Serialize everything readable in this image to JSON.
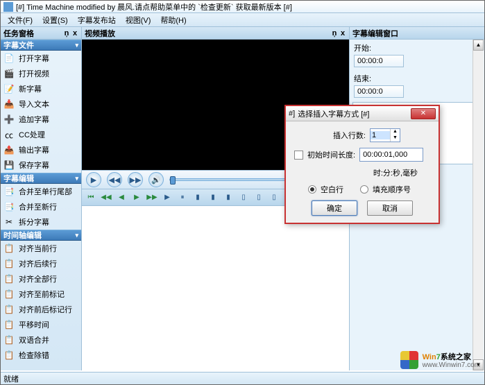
{
  "title": "[#] Time Machine modified by 晨风.请点帮助菜单中的 `检查更新` 获取最新版本 [#]",
  "menu": {
    "file": "文件(F)",
    "settings": "设置(S)",
    "publish": "字幕发布站",
    "view": "视图(V)",
    "help": "帮助(H)"
  },
  "panels": {
    "task": "任务窗格",
    "video": "视频播放",
    "edit": "字幕编辑窗口"
  },
  "pinclose": {
    "pin": "ņ",
    "close": "x"
  },
  "sidebar": {
    "sec1": {
      "title": "字幕文件",
      "items": [
        "打开字幕",
        "打开视频",
        "新字幕",
        "导入文本",
        "追加字幕",
        "CC处理",
        "输出字幕",
        "保存字幕"
      ]
    },
    "sec2": {
      "title": "字幕编辑",
      "items": [
        "合并至单行尾部",
        "合并至新行",
        "拆分字幕"
      ]
    },
    "sec3": {
      "title": "时间轴编辑",
      "items": [
        "对齐当前行",
        "对齐后续行",
        "对齐全部行",
        "对齐至前标记",
        "对齐前后标记行",
        "平移时间",
        "双语合并",
        "检查除错"
      ]
    }
  },
  "rightpanel": {
    "start": "开始:",
    "end": "结束:",
    "startv": "00:00:0",
    "endv": "00:00:0"
  },
  "dialog": {
    "title": "选择插入字幕方式 [#]",
    "insert_lines": "插入行数:",
    "lines_value": "1",
    "init_len_chk": "初始时间长度:",
    "init_len_val": "00:00:01,000",
    "time_fmt": "时:分:秒,毫秒",
    "opt_blank": "空白行",
    "opt_seq": "填充顺序号",
    "ok": "确定",
    "cancel": "取消"
  },
  "status": "就绪",
  "watermark": {
    "brand1": "Win",
    "brand2": "7",
    "brand3": "系统之家",
    "url": "www.Winwin7.com"
  }
}
